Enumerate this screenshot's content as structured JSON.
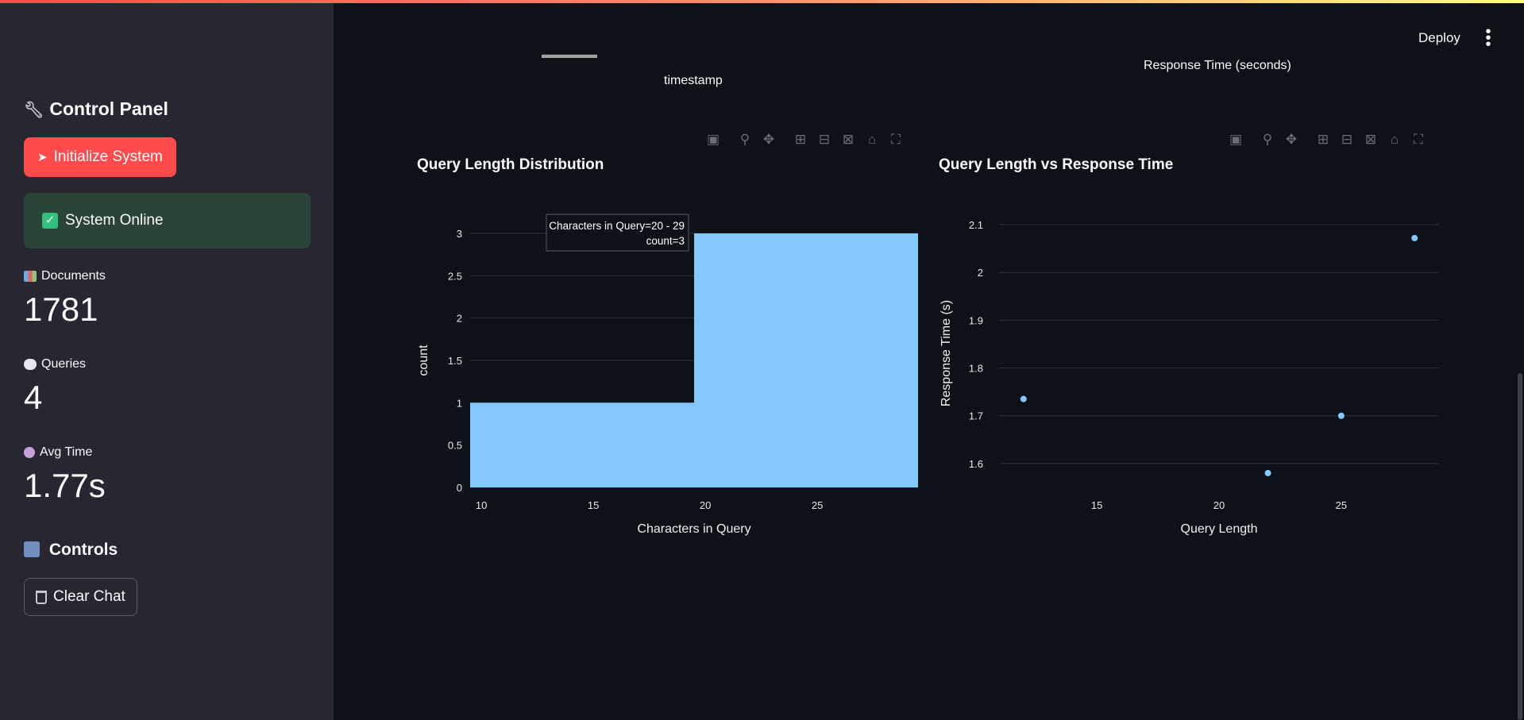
{
  "header": {
    "deploy_label": "Deploy",
    "menu_icon": "vertical-dots-icon"
  },
  "sidebar": {
    "title": "Control Panel",
    "title_icon": "wrench-icon",
    "init_button": "Initialize System",
    "init_icon": "rocket-icon",
    "status": "System Online",
    "status_icon": "check-icon",
    "metrics": [
      {
        "label": "Documents",
        "value": "1781",
        "icon": "books-icon"
      },
      {
        "label": "Queries",
        "value": "4",
        "icon": "speech-bubble-icon"
      },
      {
        "label": "Avg Time",
        "value": "1.77s",
        "icon": "clock-icon"
      }
    ],
    "controls_title": "Controls",
    "controls_icon": "control-knobs-icon",
    "clear_button": "Clear Chat",
    "clear_icon": "trash-icon"
  },
  "top_fragments": {
    "left_axis_title": "timestamp",
    "right_axis_title": "Response Time (seconds)"
  },
  "colors": {
    "accent": "#ff4b4b",
    "bar": "#83c9ff",
    "status_bg": "#2b4438"
  },
  "chart_data": [
    {
      "type": "bar",
      "title": "Query Length Distribution",
      "xlabel": "Characters in Query",
      "ylabel": "count",
      "bins": [
        {
          "start": 10,
          "end": 19,
          "count": 1
        },
        {
          "start": 20,
          "end": 29,
          "count": 3
        }
      ],
      "x_ticks": [
        "10",
        "15",
        "20",
        "25"
      ],
      "y_ticks": [
        "0",
        "0.5",
        "1",
        "1.5",
        "2",
        "2.5",
        "3"
      ],
      "xlim": [
        9.5,
        29.5
      ],
      "ylim": [
        0,
        3
      ],
      "grid": true,
      "tooltip": {
        "line1": "Characters in Query=20 - 29",
        "line2": "count=3"
      }
    },
    {
      "type": "scatter",
      "title": "Query Length vs Response Time",
      "xlabel": "Query Length",
      "ylabel": "Response Time (s)",
      "points": [
        {
          "x": 12,
          "y": 1.735
        },
        {
          "x": 22,
          "y": 1.58
        },
        {
          "x": 25,
          "y": 1.7
        },
        {
          "x": 28,
          "y": 2.072
        }
      ],
      "x_ticks": [
        "15",
        "20",
        "25"
      ],
      "y_ticks": [
        "1.6",
        "1.7",
        "1.8",
        "1.9",
        "2",
        "2.1"
      ],
      "xlim": [
        11,
        29
      ],
      "ylim": [
        1.55,
        2.13
      ],
      "grid": true
    }
  ]
}
